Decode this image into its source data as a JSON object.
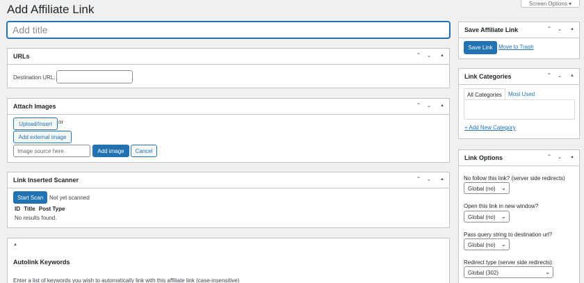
{
  "header": {
    "title": "Add Affiliate Link",
    "screen_options": "Screen Options ▾"
  },
  "title_field": {
    "placeholder": "Add title",
    "value": ""
  },
  "box_controls": {
    "up": "⌃",
    "down": "⌄",
    "toggle": "▲"
  },
  "urls_box": {
    "title": "URLs",
    "destination_label": "Destination URL:",
    "destination_value": ""
  },
  "attach_images_box": {
    "title": "Attach Images",
    "upload_label": "Upload/Insert",
    "or_text": "or",
    "add_external_label": "Add external image",
    "image_source_placeholder": "Image source here",
    "add_image_label": "Add image",
    "cancel_label": "Cancel"
  },
  "scanner_box": {
    "title": "Link Inserted Scanner",
    "start_scan_label": "Start Scan",
    "status": "Not yet scanned",
    "columns": [
      "ID",
      "Title",
      "Post Type"
    ],
    "empty_message": "No results found."
  },
  "autolink_box": {
    "title": "Autolink Keywords",
    "description": "Enter a list of keywords you wish to automatically link with this affiliate link (case-insensitive)"
  },
  "save_box": {
    "title": "Save Affiliate Link",
    "save_label": "Save Link",
    "trash_label": "Move to Trash"
  },
  "categories_box": {
    "title": "Link Categories",
    "tabs": [
      "All Categories",
      "Most Used"
    ],
    "add_new_label": "+ Add New Category"
  },
  "options_box": {
    "title": "Link Options",
    "nofollow_label": "No follow this link? (server side redirects)",
    "nofollow_value": "Global (no)",
    "new_window_label": "Open this link in new window?",
    "new_window_value": "Global (no)",
    "pass_query_label": "Pass query string to destination url?",
    "pass_query_value": "Global (no)",
    "redirect_label": "Redirect type (server side redirects):",
    "redirect_value": "Global (302)"
  }
}
